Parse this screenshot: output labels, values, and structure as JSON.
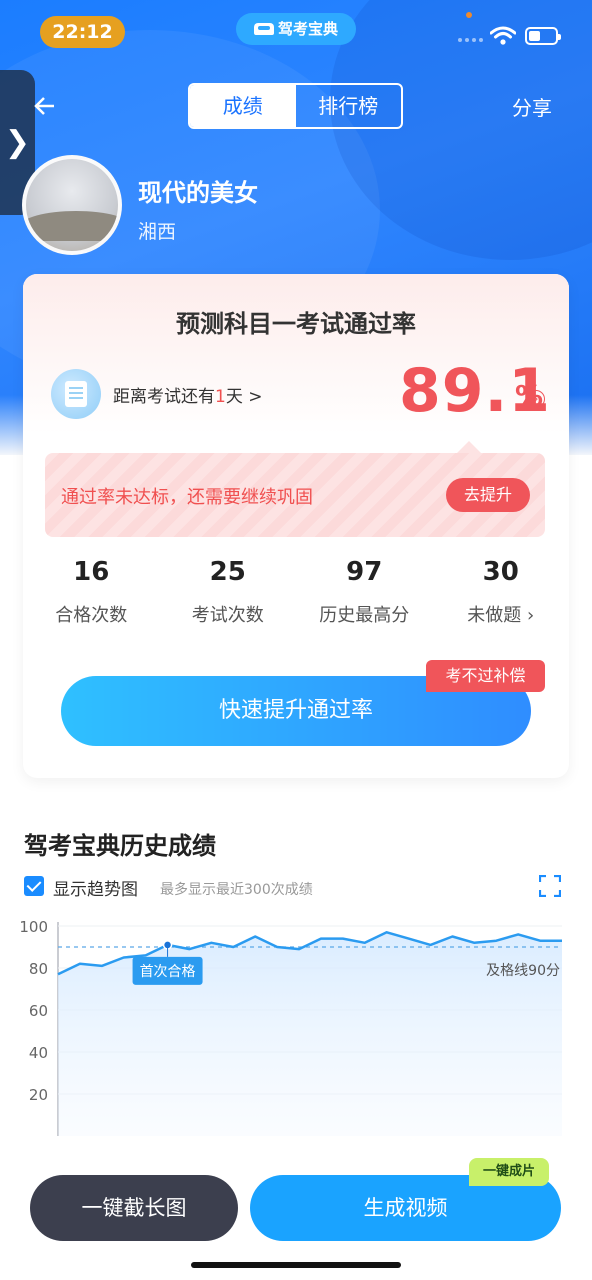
{
  "status": {
    "time": "22:12",
    "brand": "驾考宝典"
  },
  "nav": {
    "tabs": [
      "成绩",
      "排行榜"
    ],
    "share": "分享"
  },
  "profile": {
    "name": "现代的美女",
    "region": "湘西"
  },
  "card": {
    "title": "预测科目一考试通过率",
    "countdown_prefix": "距离考试还有",
    "countdown_num": "1",
    "countdown_suffix": "天 >",
    "rate": "89.1",
    "rate_unit": "%",
    "warning": "通过率未达标，还需要继续巩固",
    "improve_button": "去提升",
    "stats": [
      {
        "value": "16",
        "label": "合格次数"
      },
      {
        "value": "25",
        "label": "考试次数"
      },
      {
        "value": "97",
        "label": "历史最高分"
      },
      {
        "value": "30",
        "label": "未做题 ›"
      }
    ],
    "compensation_tag": "考不过补偿",
    "boost_button": "快速提升通过率"
  },
  "history": {
    "title": "驾考宝典历史成绩",
    "trend_label": "显示趋势图",
    "trend_hint": "最多显示最近300次成绩"
  },
  "chart_data": {
    "type": "line",
    "ylim": [
      0,
      100
    ],
    "yticks": [
      20,
      40,
      60,
      80,
      100
    ],
    "pass_line": 90,
    "pass_line_label": "及格线90分",
    "first_pass_label": "首次合格",
    "first_pass_index": 5,
    "values": [
      77,
      82,
      81,
      85,
      86,
      91,
      89,
      92,
      90,
      95,
      90,
      89,
      94,
      94,
      92,
      97,
      94,
      91,
      95,
      92,
      93,
      96,
      93,
      93
    ]
  },
  "bottom": {
    "screenshot_button": "一键截长图",
    "video_button": "生成视频",
    "video_badge": "一键成片"
  },
  "colors": {
    "primary": "#1a7dff",
    "danger": "#f0555a"
  }
}
